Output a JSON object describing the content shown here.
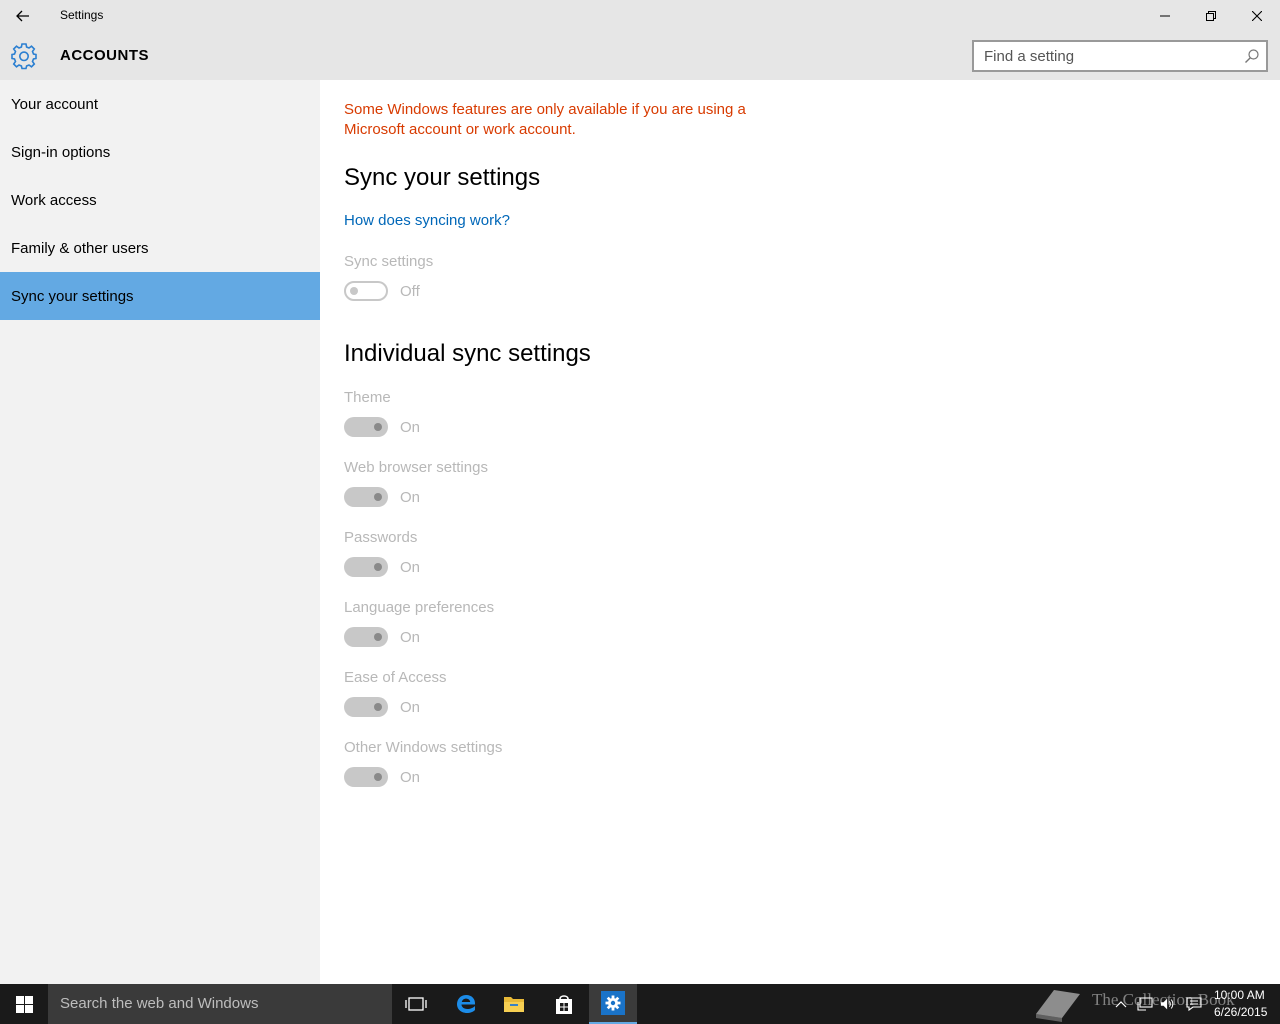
{
  "window": {
    "title": "Settings"
  },
  "header": {
    "section_title": "ACCOUNTS",
    "search_placeholder": "Find a setting"
  },
  "sidebar": {
    "items": [
      {
        "label": "Your account",
        "active": false
      },
      {
        "label": "Sign-in options",
        "active": false
      },
      {
        "label": "Work access",
        "active": false
      },
      {
        "label": "Family & other users",
        "active": false
      },
      {
        "label": "Sync your settings",
        "active": true
      }
    ]
  },
  "main": {
    "warning": "Some Windows features are only available if you are using a Microsoft account or work account.",
    "sync_title": "Sync your settings",
    "how_link": "How does syncing work?",
    "sync_settings": {
      "label": "Sync settings",
      "state": "Off"
    },
    "individual_title": "Individual sync settings",
    "individual": [
      {
        "label": "Theme",
        "state": "On"
      },
      {
        "label": "Web browser settings",
        "state": "On"
      },
      {
        "label": "Passwords",
        "state": "On"
      },
      {
        "label": "Language preferences",
        "state": "On"
      },
      {
        "label": "Ease of Access",
        "state": "On"
      },
      {
        "label": "Other Windows settings",
        "state": "On"
      }
    ]
  },
  "taskbar": {
    "search_text": "Search the web and Windows",
    "time": "10:00 AM",
    "date": "6/26/2015",
    "watermark": "The Collection Book"
  },
  "colors": {
    "accent": "#63a9e3",
    "warning": "#d83b01",
    "link": "#0067b8",
    "disabled_text": "#b8b8b8"
  }
}
